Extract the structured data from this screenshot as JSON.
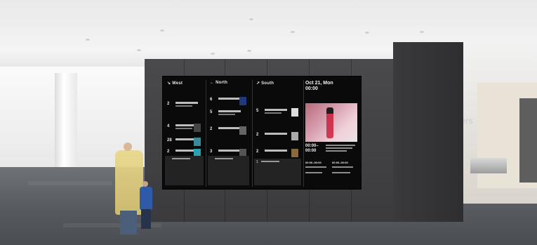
{
  "signage": {
    "columns": [
      {
        "header": "↘ West",
        "rows": [
          "2",
          "4",
          "28",
          "2"
        ]
      },
      {
        "header": "← North",
        "rows": [
          "6",
          "5",
          "2",
          "3"
        ]
      },
      {
        "header": "↗ South",
        "rows": [
          "5",
          "2",
          "2",
          "1"
        ]
      }
    ],
    "date_line1": "Oct 21, Mon",
    "date_line2": "00:00",
    "featured_time": "00:00–\n00:00",
    "schedule": [
      "00:00–00:00",
      "00:00–00:00"
    ]
  },
  "environment": {
    "room_sign": "bers"
  },
  "colors": {
    "screen_bg": "#0a0a0a",
    "kiosk": "#3f3f41",
    "featured_accent": "#c8324a"
  }
}
